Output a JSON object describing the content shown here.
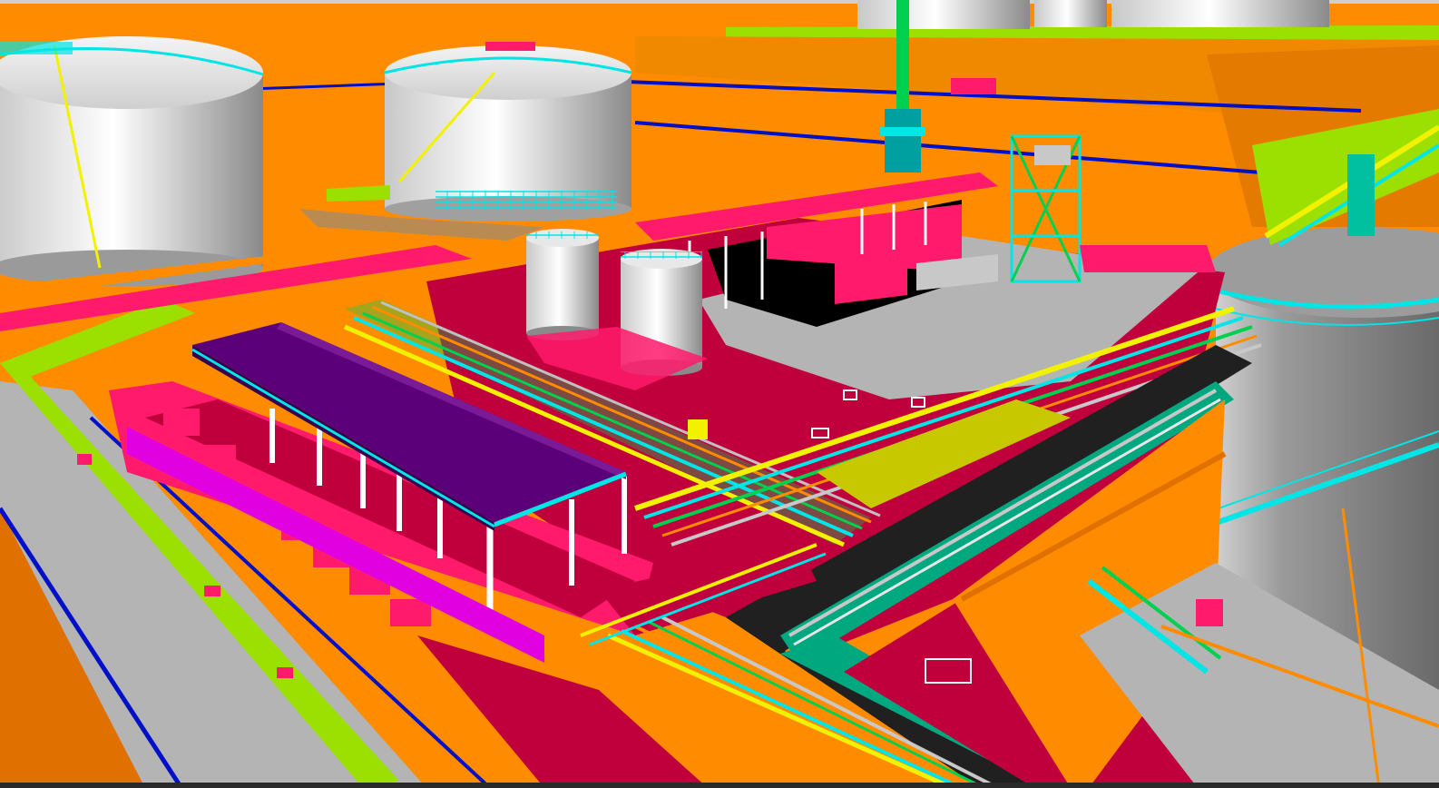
{
  "viewer": {
    "background_color": "#000000",
    "palette": {
      "terrain": "#ff8c00",
      "terrain_dark": "#e07000",
      "paving_grey": "#b4b4b4",
      "slab_crimson": "#c0003c",
      "structure_pink": "#ff1a6b",
      "tank_white": "#e8e8e8",
      "roof_purple": "#5c007a",
      "lime": "#9be000",
      "pipe_cyan": "#00e5e5",
      "pipe_yellow": "#f2f200",
      "pipe_green": "#00d050",
      "teal_trench": "#00a880",
      "dark_trench": "#202020",
      "blue_kerb": "#0010c8",
      "magenta": "#e000e0",
      "olive": "#c8c800",
      "white_steel": "#ffffff"
    }
  }
}
